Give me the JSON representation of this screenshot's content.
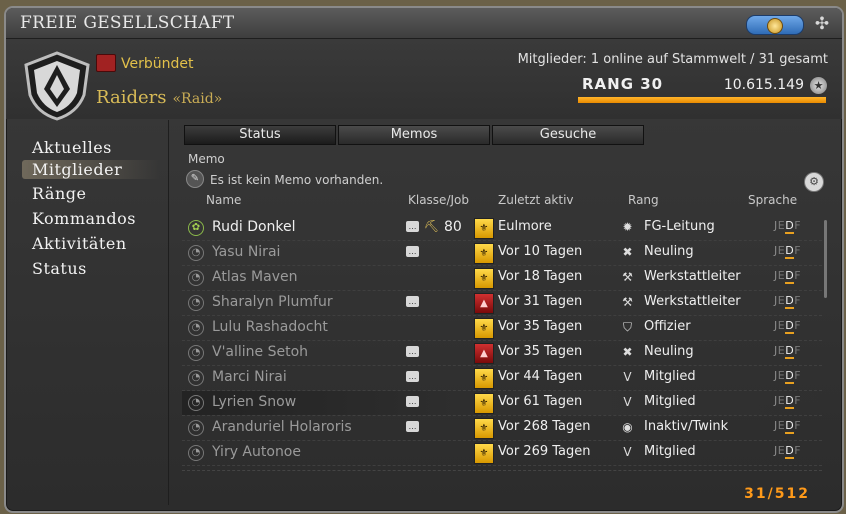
{
  "window": {
    "title": "FREIE GESELLSCHAFT"
  },
  "header": {
    "alliance": "Verbündet",
    "fc_name": "Raiders",
    "fc_tag": "«Raid»",
    "members_summary": "Mitglieder: 1 online auf Stammwelt / 31 gesamt",
    "rank_label": "RANG 30",
    "points": "10.615.149"
  },
  "sidebar": {
    "items": [
      {
        "label": "Aktuelles"
      },
      {
        "label": "Mitglieder"
      },
      {
        "label": "Ränge"
      },
      {
        "label": "Kommandos"
      },
      {
        "label": "Aktivitäten"
      },
      {
        "label": "Status"
      }
    ],
    "selected": "Mitglieder"
  },
  "tabs": [
    {
      "label": "Status"
    },
    {
      "label": "Memos"
    },
    {
      "label": "Gesuche"
    }
  ],
  "memo": {
    "label": "Memo",
    "text": "Es ist kein Memo vorhanden."
  },
  "columns": {
    "name": "Name",
    "class_job": "Klasse/Job",
    "last_active": "Zuletzt aktiv",
    "rank": "Rang",
    "language": "Sprache"
  },
  "rows": [
    {
      "name": "Rudi Donkel",
      "online": true,
      "chat": true,
      "level": "80",
      "city": "gold",
      "last": "Eulmore",
      "rank": "FG-Leitung",
      "rank_icon": "crown-icon"
    },
    {
      "name": "Yasu Nirai",
      "online": false,
      "chat": true,
      "level": "",
      "city": "gold",
      "last": "Vor 10 Tagen",
      "rank": "Neuling",
      "rank_icon": "x-icon"
    },
    {
      "name": "Atlas Maven",
      "online": false,
      "chat": false,
      "level": "",
      "city": "gold",
      "last": "Vor 18 Tagen",
      "rank": "Werkstattleiter",
      "rank_icon": "hammer-icon"
    },
    {
      "name": "Sharalyn Plumfur",
      "online": false,
      "chat": true,
      "level": "",
      "city": "red",
      "last": "Vor 31 Tagen",
      "rank": "Werkstattleiter",
      "rank_icon": "hammer-icon"
    },
    {
      "name": "Lulu Rashadocht",
      "online": false,
      "chat": false,
      "level": "",
      "city": "gold",
      "last": "Vor 35 Tagen",
      "rank": "Offizier",
      "rank_icon": "shield-icon"
    },
    {
      "name": "V'alline Setoh",
      "online": false,
      "chat": true,
      "level": "",
      "city": "red",
      "last": "Vor 35 Tagen",
      "rank": "Neuling",
      "rank_icon": "x-icon"
    },
    {
      "name": "Marci Nirai",
      "online": false,
      "chat": true,
      "level": "",
      "city": "gold",
      "last": "Vor 44 Tagen",
      "rank": "Mitglied",
      "rank_icon": "v-icon"
    },
    {
      "name": "Lyrien Snow",
      "online": false,
      "chat": true,
      "level": "",
      "city": "gold",
      "last": "Vor 61 Tagen",
      "rank": "Mitglied",
      "rank_icon": "v-icon"
    },
    {
      "name": "Aranduriel Holaroris",
      "online": false,
      "chat": true,
      "level": "",
      "city": "gold",
      "last": "Vor 268 Tagen",
      "rank": "Inaktiv/Twink",
      "rank_icon": "circle-icon"
    },
    {
      "name": "Yiry Autonoe",
      "online": false,
      "chat": false,
      "level": "",
      "city": "gold",
      "last": "Vor 269 Tagen",
      "rank": "Mitglied",
      "rank_icon": "v-icon"
    }
  ],
  "language_letters": [
    "J",
    "E",
    "D",
    "F"
  ],
  "counter": "31/512",
  "colors": {
    "accent": "#e98a00",
    "gold_text": "#d8bb57",
    "counter": "#ff9a1a"
  }
}
